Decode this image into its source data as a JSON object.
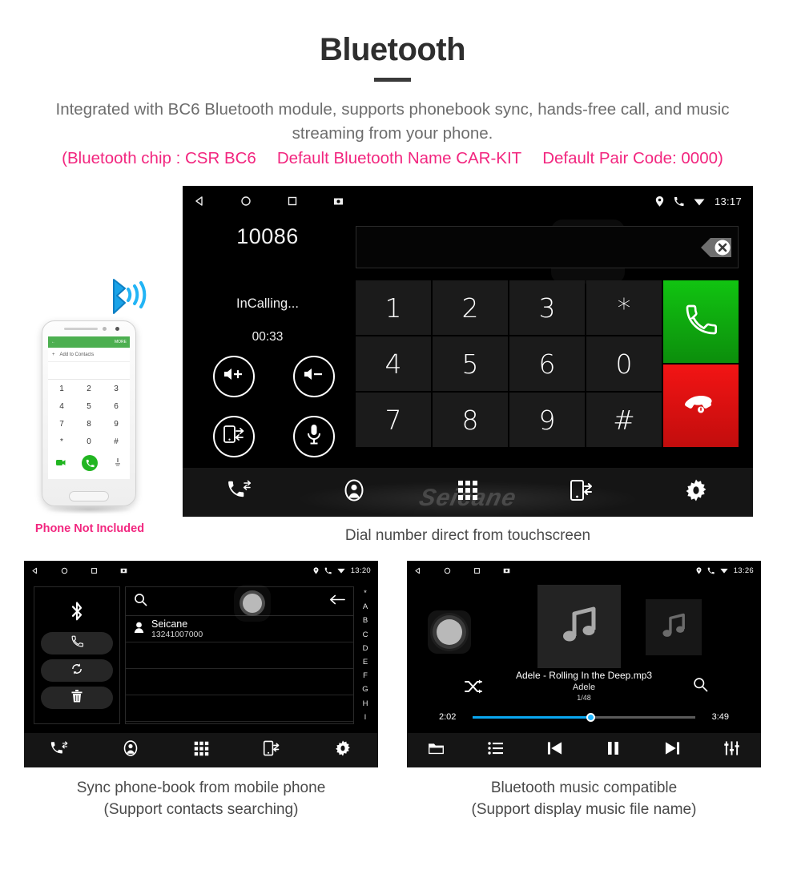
{
  "header": {
    "title": "Bluetooth",
    "description": "Integrated with BC6 Bluetooth module, supports phonebook sync, hands-free call, and music streaming from your phone.",
    "spec_chip": "(Bluetooth chip : CSR BC6",
    "spec_name": "Default Bluetooth Name CAR-KIT",
    "spec_pair": "Default Pair Code: 0000)",
    "accent_pink": "#f2267f",
    "body_gray": "#6d6d6d"
  },
  "phone_mockup": {
    "note": "Phone Not Included",
    "statusbar_more": "MORE",
    "add_to_contacts": "Add to Contacts",
    "keys": [
      "1",
      "2",
      "3",
      "4",
      "5",
      "6",
      "7",
      "8",
      "9",
      "*",
      "0",
      "#"
    ],
    "bluetooth_icon": "bluetooth-signal-icon",
    "call_icon": "phone-handset-icon"
  },
  "main_screen": {
    "statusbar": {
      "back_icon": "back-triangle-icon",
      "home_icon": "home-circle-icon",
      "recents_icon": "recents-square-icon",
      "screenshot_icon": "screenshot-icon",
      "location_icon": "location-pin-icon",
      "call_icon": "phone-handset-icon",
      "wifi_icon": "wifi-icon",
      "time": "13:17"
    },
    "dialed_number": "10086",
    "input_value": "",
    "clear_icon": "backspace-clear-icon",
    "call_state": "InCalling...",
    "call_duration": "00:33",
    "controls": [
      {
        "name": "volume-up-button",
        "icon": "speaker-plus-icon"
      },
      {
        "name": "volume-down-button",
        "icon": "speaker-minus-icon"
      },
      {
        "name": "transfer-to-phone-button",
        "icon": "phone-transfer-icon"
      },
      {
        "name": "mute-microphone-button",
        "icon": "microphone-icon"
      }
    ],
    "keypad": [
      "1",
      "2",
      "3",
      "*",
      "4",
      "5",
      "6",
      "0",
      "7",
      "8",
      "9",
      "#"
    ],
    "call_button_icon": "phone-call-icon",
    "hangup_button_icon": "phone-hangup-icon",
    "call_button_color": "#11c411",
    "hangup_button_color": "#f21414",
    "watermark": "Seicane",
    "navbar": [
      {
        "name": "nav-call-log",
        "icon": "call-log-icon"
      },
      {
        "name": "nav-contacts",
        "icon": "contact-person-icon"
      },
      {
        "name": "nav-keypad",
        "icon": "dialpad-icon"
      },
      {
        "name": "nav-phone-sync",
        "icon": "phone-sync-icon"
      },
      {
        "name": "nav-settings",
        "icon": "gear-icon"
      }
    ]
  },
  "phonebook_screen": {
    "statusbar": {
      "time": "13:20"
    },
    "sidebar": [
      {
        "name": "bluetooth-status-icon",
        "icon": "bluetooth-icon"
      },
      {
        "name": "call-contact-button",
        "icon": "phone-handset-icon"
      },
      {
        "name": "sync-contacts-button",
        "icon": "sync-refresh-icon"
      },
      {
        "name": "delete-contacts-button",
        "icon": "trash-icon"
      }
    ],
    "search_placeholder": "",
    "search_icon": "search-icon",
    "back_icon": "arrow-left-icon",
    "contacts": [
      {
        "name": "Seicane",
        "phone": "13241007000"
      }
    ],
    "empty_rows": 4,
    "alpha_index": [
      "*",
      "A",
      "B",
      "C",
      "D",
      "E",
      "F",
      "G",
      "H",
      "I"
    ],
    "navbar": [
      {
        "name": "nav-call-log",
        "icon": "call-log-icon"
      },
      {
        "name": "nav-contacts",
        "icon": "contact-person-icon"
      },
      {
        "name": "nav-keypad",
        "icon": "dialpad-icon"
      },
      {
        "name": "nav-phone-sync",
        "icon": "phone-sync-icon"
      },
      {
        "name": "nav-settings",
        "icon": "gear-icon"
      }
    ]
  },
  "music_screen": {
    "statusbar": {
      "time": "13:26"
    },
    "album_art_icon": "music-note-icon",
    "track_title": "Adele - Rolling In the Deep.mp3",
    "track_artist": "Adele",
    "track_count": "1/48",
    "shuffle_icon": "shuffle-icon",
    "search_icon": "search-icon",
    "elapsed": "2:02",
    "duration": "3:49",
    "progress_percent": 53,
    "progress_color": "#0aa7f0",
    "controls": [
      {
        "name": "music-folder-button",
        "icon": "folder-icon"
      },
      {
        "name": "music-playlist-button",
        "icon": "list-icon"
      },
      {
        "name": "music-previous-button",
        "icon": "previous-track-icon"
      },
      {
        "name": "music-pause-button",
        "icon": "pause-icon"
      },
      {
        "name": "music-next-button",
        "icon": "next-track-icon"
      },
      {
        "name": "music-equalizer-button",
        "icon": "equalizer-icon"
      }
    ]
  },
  "captions": {
    "main": "Dial number direct from touchscreen",
    "phonebook_line1": "Sync phone-book from mobile phone",
    "phonebook_line2": "(Support contacts searching)",
    "music_line1": "Bluetooth music compatible",
    "music_line2": "(Support display music file name)"
  }
}
